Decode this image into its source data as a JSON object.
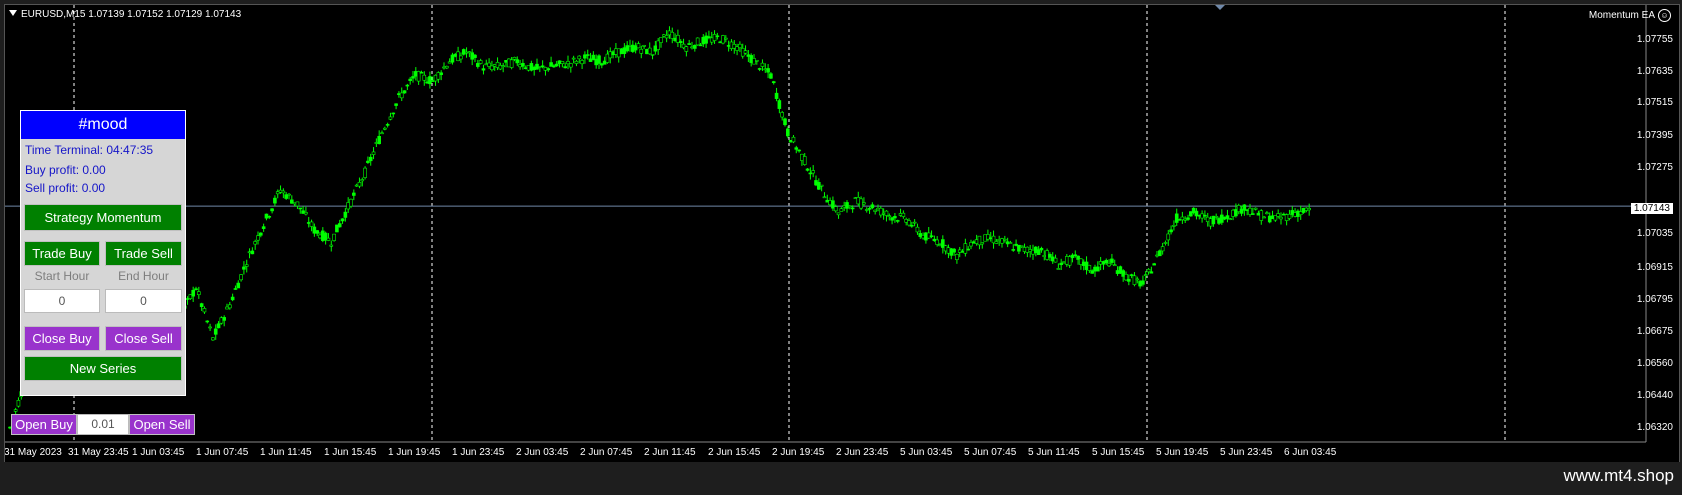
{
  "header": {
    "symbol_info": "EURUSD,M15  1.07139 1.07152 1.07129 1.07143"
  },
  "ea_label": "Momentum EA",
  "ea_icon": "smiley-icon",
  "price_axis": [
    "1.07755",
    "1.07635",
    "1.07515",
    "1.07395",
    "1.07275",
    "1.07143",
    "1.07035",
    "1.06915",
    "1.06795",
    "1.06675",
    "1.06560",
    "1.06440",
    "1.06320"
  ],
  "current_price": "1.07143",
  "time_axis": [
    "31 May 2023",
    "31 May 23:45",
    "1 Jun 03:45",
    "1 Jun 07:45",
    "1 Jun 11:45",
    "1 Jun 15:45",
    "1 Jun 19:45",
    "1 Jun 23:45",
    "2 Jun 03:45",
    "2 Jun 07:45",
    "2 Jun 11:45",
    "2 Jun 15:45",
    "2 Jun 19:45",
    "2 Jun 23:45",
    "5 Jun 03:45",
    "5 Jun 07:45",
    "5 Jun 11:45",
    "5 Jun 15:45",
    "5 Jun 19:45",
    "5 Jun 23:45",
    "6 Jun 03:45"
  ],
  "panel": {
    "title": "#mood",
    "time_terminal": "Time Terminal: 04:47:35",
    "buy_profit": "Buy profit: 0.00",
    "sell_profit": "Sell profit: 0.00",
    "strategy_button": "Strategy Momentum",
    "trade_buy": "Trade Buy",
    "trade_sell": "Trade Sell",
    "start_hour_label": "Start Hour",
    "end_hour_label": "End Hour",
    "start_hour_value": "0",
    "end_hour_value": "0",
    "close_buy": "Close Buy",
    "close_sell": "Close Sell",
    "new_series": "New Series"
  },
  "trade_bar": {
    "open_buy": "Open Buy",
    "lot_value": "0.01",
    "open_sell": "Open Sell"
  },
  "watermark": "www.mt4.shop",
  "colors": {
    "candle": "#00ff00",
    "panel_title": "#0000ff",
    "green_button": "#008000",
    "purple_button": "#9933cc",
    "info_text": "#1515c8"
  },
  "chart_data": {
    "type": "line",
    "series": [
      {
        "values": [
          1.0637,
          1.0655,
          1.0672,
          1.069,
          1.07,
          1.0705,
          1.0693,
          1.0685,
          1.0688,
          1.068,
          1.0675,
          1.0686,
          1.0668,
          1.068,
          1.0695,
          1.0708,
          1.072,
          1.0715,
          1.0706,
          1.0702,
          1.0714,
          1.0726,
          1.074,
          1.0752,
          1.076,
          1.0758,
          1.0765,
          1.0768,
          1.0763,
          1.0763,
          1.0765,
          1.0762,
          1.0763,
          1.0764,
          1.0766,
          1.0765,
          1.0768,
          1.077,
          1.0768,
          1.0775,
          1.077,
          1.0772,
          1.0773,
          1.077,
          1.0765,
          1.076,
          1.074,
          1.073,
          1.072,
          1.0712,
          1.0716,
          1.0714,
          1.0711,
          1.071,
          1.0704,
          1.0702,
          1.0697,
          1.0702,
          1.0703,
          1.0701,
          1.0699,
          1.0699,
          1.0694,
          1.0696,
          1.0692,
          1.0695,
          1.069,
          1.0687,
          1.0698,
          1.071,
          1.0712,
          1.0709,
          1.0711,
          1.0714,
          1.0711,
          1.071,
          1.0712,
          1.0713
        ]
      }
    ],
    "ylim": [
      1.0632,
      1.0781
    ],
    "grid": true
  }
}
